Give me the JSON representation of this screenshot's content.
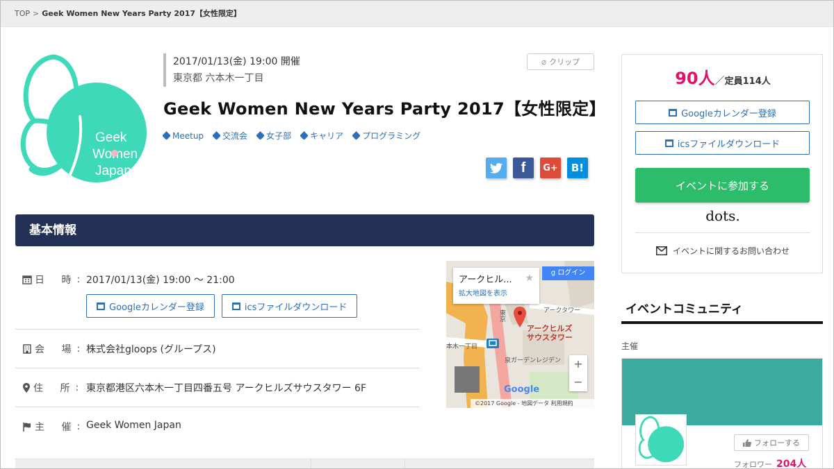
{
  "breadcrumb": {
    "top": "TOP",
    "separator": ">",
    "current": "Geek Women New Years Party 2017【女性限定】"
  },
  "event": {
    "datetime": "2017/01/13(金) 19:00 開催",
    "place": "東京都 六本木一丁目",
    "title": "Geek Women New Years Party 2017【女性限定】",
    "clip_label": "クリップ",
    "tags": [
      "Meetup",
      "交流会",
      "女子部",
      "キャリア",
      "プログラミング"
    ],
    "logo_text": [
      "Geek",
      "Women",
      "Japan"
    ]
  },
  "social": {
    "twitter": "t",
    "facebook": "f",
    "googleplus": "G+",
    "hatena": "B!"
  },
  "section": {
    "basic_info": "基本情報"
  },
  "info": {
    "date_label": "日 時",
    "date_value": "2017/01/13(金) 19:00 〜 21:00",
    "google_cal": "Googleカレンダー登録",
    "ics_download": "icsファイルダウンロード",
    "venue_label": "会 場",
    "venue_value": "株式会社gloops (グループス)",
    "address_label": "住 所",
    "address_value": "東京都港区六本木一丁目四番五号 アークヒルズサウスタワー 6F",
    "host_label": "主 催",
    "host_value": "Geek Women Japan"
  },
  "map": {
    "card_title": "アークヒル...",
    "expand_link": "拡大地図を表示",
    "login": "ログイン",
    "pin_label_1": "アークヒルズ",
    "pin_label_2": "サウスタワー",
    "label_tower": "アークタワー",
    "label_station": "本木一丁目",
    "label_garden": "泉ガーデンレジデン",
    "label_road": "東京",
    "google": "Google",
    "footer": "©2017 Google - 地図データ  利用規約",
    "zoom_in": "+",
    "zoom_out": "−"
  },
  "sidebar": {
    "count": "90人",
    "slash": "／",
    "capacity": "定員114人",
    "google_cal": "Googleカレンダー登録",
    "ics_download": "icsファイルダウンロード",
    "join": "イベントに参加する",
    "sponsor_logo": "dots.",
    "contact": "イベントに関するお問い合わせ",
    "community_title": "イベントコミュニティ",
    "host_label": "主催",
    "follow": "フォローする",
    "followers_label": "フォロワー",
    "followers_count": "204人"
  },
  "colors": {
    "navy": "#233157",
    "accent_pink": "#e2126f",
    "join_green": "#2dbc6a",
    "link_blue": "#2a6fb8",
    "logo_teal": "#3dd9b8"
  }
}
